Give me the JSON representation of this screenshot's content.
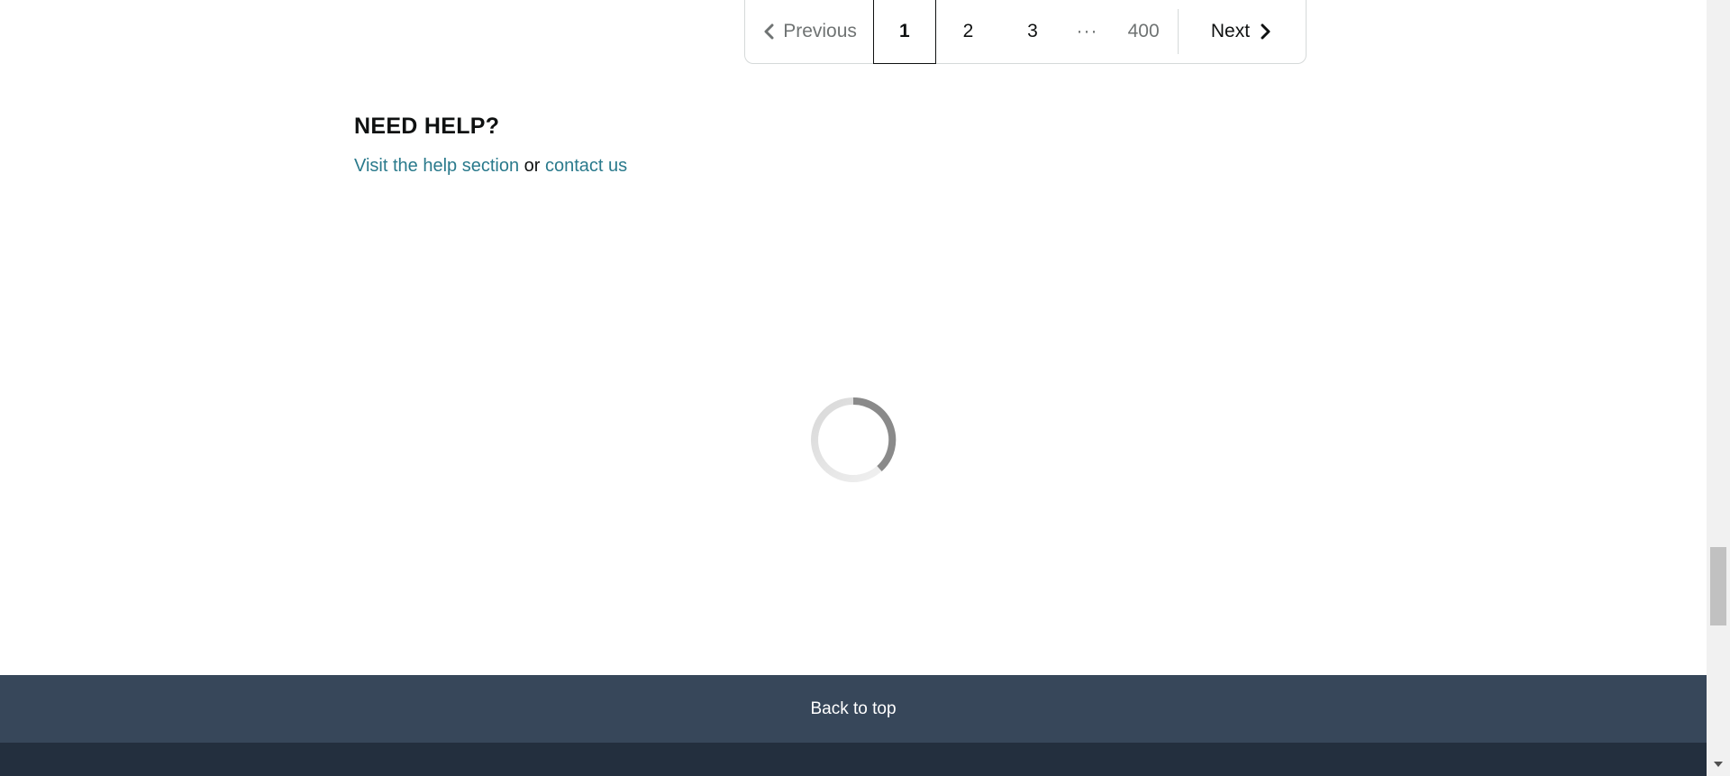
{
  "pagination": {
    "previous_label": "Previous",
    "current_page": "1",
    "pages": [
      "2",
      "3"
    ],
    "ellipsis": "···",
    "last_page": "400",
    "next_label": "Next"
  },
  "help": {
    "title": "NEED HELP?",
    "help_link": "Visit the help section",
    "connector": " or ",
    "contact_link": "contact us"
  },
  "footer": {
    "back_to_top": "Back to top"
  },
  "colors": {
    "link": "#2a7a8c",
    "back_to_top_bg": "#37475a",
    "footer_bg": "#232f3e"
  },
  "icons": {
    "previous": "chevron-left-icon",
    "next": "chevron-right-icon",
    "loading": "loading-spinner-icon"
  }
}
